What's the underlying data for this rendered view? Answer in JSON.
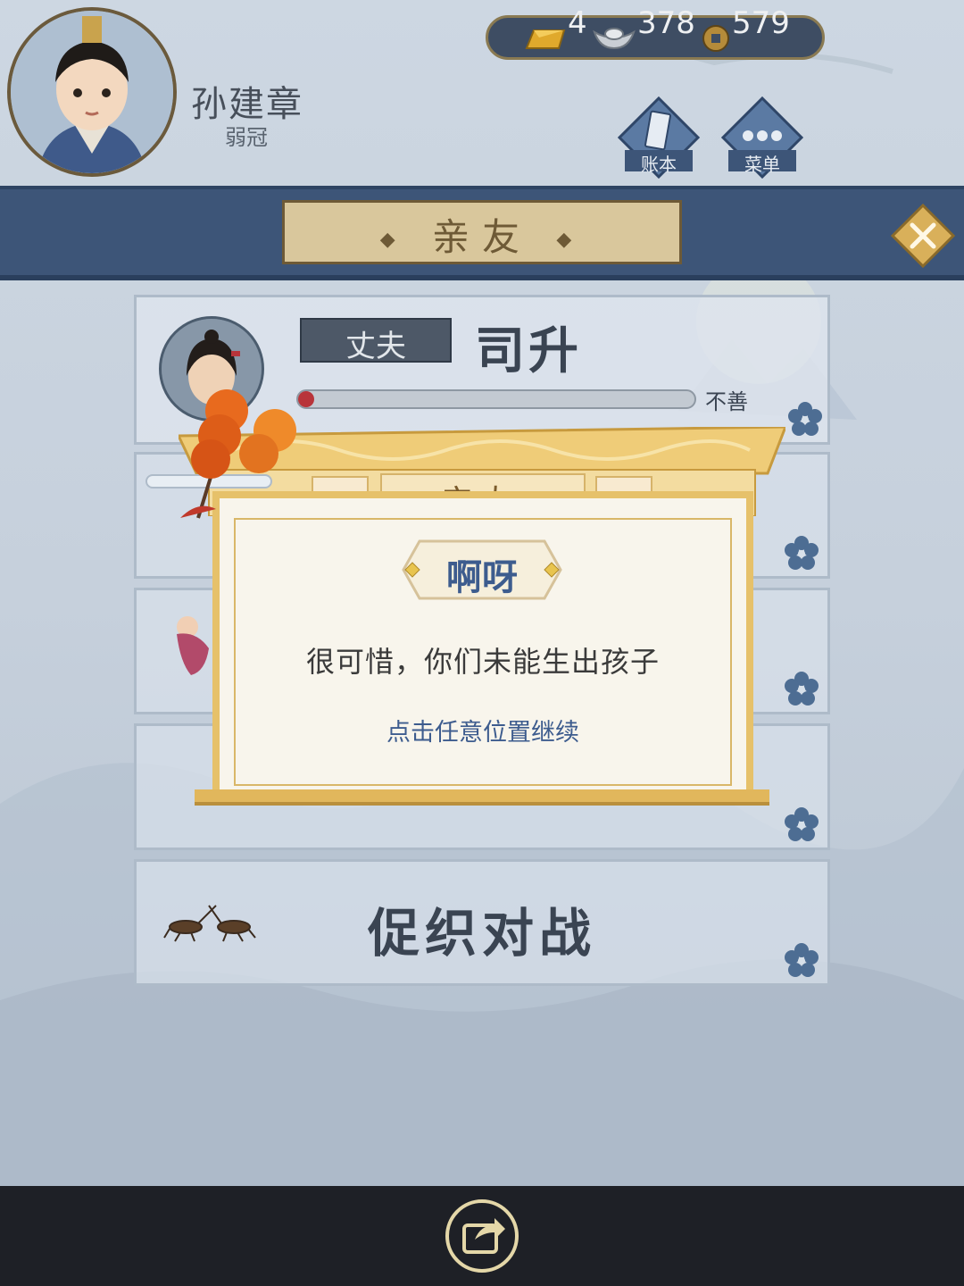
{
  "player": {
    "name": "孙建章",
    "age_title": "弱冠"
  },
  "currency": {
    "gold": "4",
    "silver": "378",
    "coins": "579"
  },
  "top_buttons": {
    "ledger_label": "账本",
    "menu_label": "菜单"
  },
  "banner": {
    "title": "亲友"
  },
  "spouse_card": {
    "relation": "丈夫",
    "name": "司升",
    "favor_label": "不善",
    "favor_level_fraction": 0.04
  },
  "cricket_card": {
    "label": "促织对战"
  },
  "dialog": {
    "title": "亲友",
    "badge": "啊呀",
    "message": "很可惜，你们未能生出孩子",
    "hint": "点击任意位置继续"
  },
  "colors": {
    "banner_blue": "#3d5578",
    "gold_frame": "#e6c16a",
    "favor_bar_red": "#b8343a",
    "hint_blue": "#3d5c8e"
  },
  "icons": {
    "gold_ingot": "gold-bar-icon",
    "silver_ingot": "silver-ingot-icon",
    "copper_coin": "coin-icon",
    "ledger": "ledger-icon",
    "menu": "menu-dots-icon",
    "close": "close-icon",
    "share": "share-icon",
    "flower": "plum-flower-icon"
  }
}
